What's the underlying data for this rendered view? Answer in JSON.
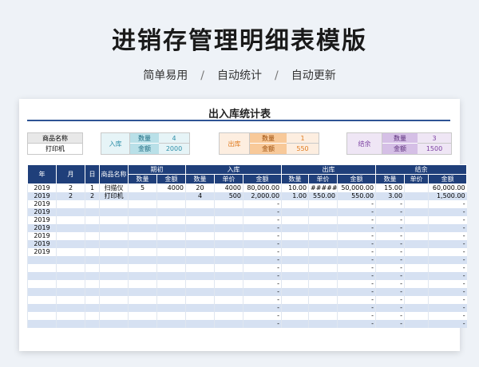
{
  "header": {
    "title": "进销存管理明细表模版",
    "tags": [
      "简单易用",
      "自动统计",
      "自动更新"
    ],
    "sep": "/"
  },
  "sheet": {
    "title": "出入库统计表",
    "product": {
      "label": "商品名称",
      "value": "打印机"
    },
    "inbound": {
      "label": "入库",
      "qty_label": "数量",
      "qty": "4",
      "amt_label": "金额",
      "amt": "2000"
    },
    "outbound": {
      "label": "出库",
      "qty_label": "数量",
      "qty": "1",
      "amt_label": "金额",
      "amt": "550"
    },
    "balance": {
      "label": "结余",
      "qty_label": "数量",
      "qty": "3",
      "amt_label": "金额",
      "amt": "1500"
    }
  },
  "table": {
    "group_headers": [
      "期初",
      "入库",
      "出库",
      "结余"
    ],
    "headers": [
      "年",
      "月",
      "日",
      "商品名称",
      "数量",
      "金额",
      "数量",
      "单价",
      "金额",
      "数量",
      "单价",
      "金额",
      "数量",
      "单价",
      "金额"
    ],
    "rows": [
      [
        "2019",
        "2",
        "1",
        "扫描仪",
        "5",
        "4000",
        "20",
        "4000",
        "80,000.00",
        "10.00",
        "#######",
        "50,000.00",
        "15.00",
        "",
        "60,000.00"
      ],
      [
        "2019",
        "2",
        "2",
        "打印机",
        "",
        "",
        "4",
        "500",
        "2,000.00",
        "1.00",
        "550.00",
        "550.00",
        "3.00",
        "",
        "1,500.00"
      ],
      [
        "2019",
        "",
        "",
        "",
        "",
        "",
        "",
        "",
        "-",
        "",
        "",
        "-",
        "-",
        "",
        "-"
      ],
      [
        "2019",
        "",
        "",
        "",
        "",
        "",
        "",
        "",
        "-",
        "",
        "",
        "-",
        "-",
        "",
        "-"
      ],
      [
        "2019",
        "",
        "",
        "",
        "",
        "",
        "",
        "",
        "-",
        "",
        "",
        "-",
        "-",
        "",
        "-"
      ],
      [
        "2019",
        "",
        "",
        "",
        "",
        "",
        "",
        "",
        "-",
        "",
        "",
        "-",
        "-",
        "",
        "-"
      ],
      [
        "2019",
        "",
        "",
        "",
        "",
        "",
        "",
        "",
        "-",
        "",
        "",
        "-",
        "-",
        "",
        "-"
      ],
      [
        "2019",
        "",
        "",
        "",
        "",
        "",
        "",
        "",
        "-",
        "",
        "",
        "-",
        "-",
        "",
        "-"
      ],
      [
        "2019",
        "",
        "",
        "",
        "",
        "",
        "",
        "",
        "-",
        "",
        "",
        "-",
        "-",
        "",
        "-"
      ],
      [
        "",
        "",
        "",
        "",
        "",
        "",
        "",
        "",
        "-",
        "",
        "",
        "-",
        "-",
        "",
        "-"
      ],
      [
        "",
        "",
        "",
        "",
        "",
        "",
        "",
        "",
        "-",
        "",
        "",
        "-",
        "-",
        "",
        "-"
      ],
      [
        "",
        "",
        "",
        "",
        "",
        "",
        "",
        "",
        "-",
        "",
        "",
        "-",
        "-",
        "",
        "-"
      ],
      [
        "",
        "",
        "",
        "",
        "",
        "",
        "",
        "",
        "-",
        "",
        "",
        "-",
        "-",
        "",
        "-"
      ],
      [
        "",
        "",
        "",
        "",
        "",
        "",
        "",
        "",
        "-",
        "",
        "",
        "-",
        "-",
        "",
        "-"
      ],
      [
        "",
        "",
        "",
        "",
        "",
        "",
        "",
        "",
        "-",
        "",
        "",
        "-",
        "-",
        "",
        "-"
      ],
      [
        "",
        "",
        "",
        "",
        "",
        "",
        "",
        "",
        "-",
        "",
        "",
        "-",
        "-",
        "",
        "-"
      ],
      [
        "",
        "",
        "",
        "",
        "",
        "",
        "",
        "",
        "-",
        "",
        "",
        "-",
        "-",
        "",
        "-"
      ],
      [
        "",
        "",
        "",
        "",
        "",
        "",
        "",
        "",
        "-",
        "",
        "",
        "-",
        "-",
        "",
        "-"
      ]
    ]
  },
  "colors": {
    "header_navy": "#1f3f7a",
    "row_blue": "#d6e1f2",
    "inbound": "#2e8fa8",
    "outbound": "#e07b1f",
    "balance": "#7a3fa0"
  }
}
